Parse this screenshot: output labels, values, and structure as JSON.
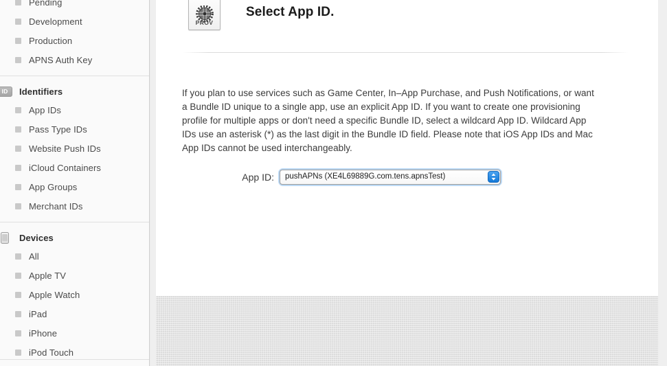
{
  "sidebar": {
    "groups": [
      {
        "heading": null,
        "icon": null,
        "items": [
          {
            "label": "Pending"
          },
          {
            "label": "Development"
          },
          {
            "label": "Production"
          },
          {
            "label": "APNS Auth Key"
          }
        ]
      },
      {
        "heading": "Identifiers",
        "icon": "id-badge-icon",
        "icon_text": "ID",
        "items": [
          {
            "label": "App IDs"
          },
          {
            "label": "Pass Type IDs"
          },
          {
            "label": "Website Push IDs"
          },
          {
            "label": "iCloud Containers"
          },
          {
            "label": "App Groups"
          },
          {
            "label": "Merchant IDs"
          }
        ]
      },
      {
        "heading": "Devices",
        "icon": "device-icon",
        "items": [
          {
            "label": "All"
          },
          {
            "label": "Apple TV"
          },
          {
            "label": "Apple Watch"
          },
          {
            "label": "iPad"
          },
          {
            "label": "iPhone"
          },
          {
            "label": "iPod Touch"
          }
        ]
      }
    ]
  },
  "main": {
    "icon_label": "PROV",
    "title": "Select App ID.",
    "description": "If you plan to use services such as Game Center, In–App Purchase, and Push Notifications, or want a Bundle ID unique to a single app, use an explicit App ID. If you want to create one provisioning profile for multiple apps or don't need a specific Bundle ID, select a wildcard App ID. Wildcard App IDs use an asterisk (*) as the last digit in the Bundle ID field. Please note that iOS App IDs and Mac App IDs cannot be used interchangeably.",
    "field": {
      "label": "App ID:",
      "selected_value": "pushAPNs (XE4L69889G.com.tens.apnsTest)"
    }
  },
  "colors": {
    "accent": "#1479d8",
    "focus_ring": "#bcd9f5",
    "panel": "#ffffff",
    "sidebar": "#fafafa",
    "linen": "#dcdcdc"
  }
}
